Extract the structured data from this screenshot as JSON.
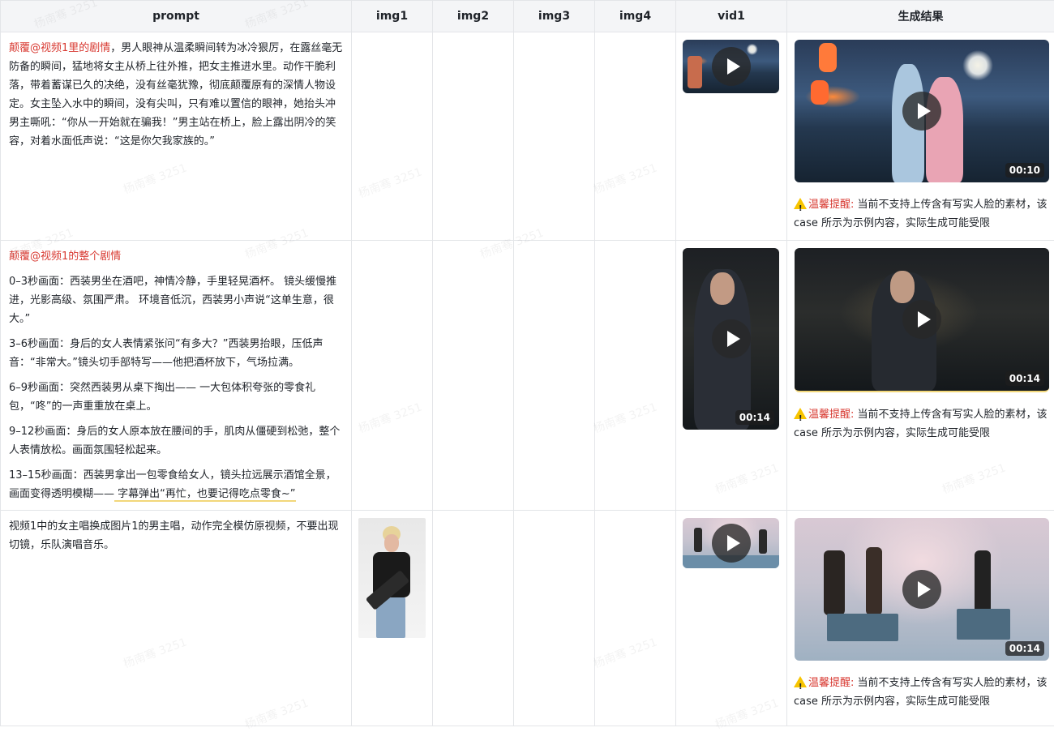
{
  "columns": [
    "prompt",
    "img1",
    "img2",
    "img3",
    "img4",
    "vid1",
    "生成结果"
  ],
  "rows": [
    {
      "paragraphs": [
        {
          "highlight": "颠覆@视频1里的剧情",
          "text": "，男人眼神从温柔瞬间转为冰冷狠厉，在露丝毫无防备的瞬间，猛地将女主从桥上往外推，把女主推进水里。动作干脆利落，带着蓄谋已久的决绝，没有丝毫犹豫，彻底颠覆原有的深情人物设定。女主坠入水中的瞬间，没有尖叫，只有难以置信的眼神，她抬头冲男主嘶吼：“你从一开始就在骗我！”男主站在桥上，脸上露出阴冷的笑容，对着水面低声说：“这是你欠我家族的。”"
        }
      ],
      "vid1": {
        "duration": "",
        "icon": "play-icon"
      },
      "result": {
        "duration": "00:10",
        "warning_label": "温馨提醒:",
        "warning_text": " 当前不支持上传含有写实人脸的素材，该 case 所示为示例内容，实际生成可能受限"
      }
    },
    {
      "paragraphs": [
        {
          "highlight": "颠覆@视频1的整个剧情",
          "text": ""
        },
        {
          "highlight": "",
          "text": "0–3秒画面：西装男坐在酒吧，神情冷静，手里轻晃酒杯。 镜头缓慢推进，光影高级、氛围严肃。 环境音低沉，西装男小声说“这单生意，很大。”"
        },
        {
          "highlight": "",
          "text": "3–6秒画面：身后的女人表情紧张问“有多大？”西装男抬眼，压低声音：“非常大。”镜头切手部特写——他把酒杯放下，气场拉满。"
        },
        {
          "highlight": "",
          "text": "6–9秒画面：突然西装男从桌下掏出—— 一大包体积夸张的零食礼包，“咚”的一声重重放在桌上。"
        },
        {
          "highlight": "",
          "text": "9–12秒画面：身后的女人原本放在腰间的手，肌肉从僵硬到松弛，整个人表情放松。画面氛围轻松起来。"
        },
        {
          "highlight": "",
          "text": "13–15秒画面：西装男拿出一包零食给女人，镜头拉远展示酒馆全景，画面变得透明模糊——",
          "underlined": " 字幕弹出“再忙，也要记得吃点零食~”"
        }
      ],
      "vid1": {
        "duration": "00:14",
        "icon": "play-icon"
      },
      "result": {
        "duration": "00:14",
        "warning_label": "温馨提醒:",
        "warning_text": " 当前不支持上传含有写实人脸的素材，该 case 所示为示例内容，实际生成可能受限"
      }
    },
    {
      "paragraphs": [
        {
          "highlight": "",
          "text": "视频1中的女主唱换成图片1的男主唱，动作完全模仿原视频，不要出现切镜，乐队演唱音乐。"
        }
      ],
      "vid1": {
        "duration": "",
        "icon": "play-icon"
      },
      "result": {
        "duration": "00:14",
        "warning_label": "温馨提醒:",
        "warning_text": " 当前不支持上传含有写实人脸的素材，该 case 所示为示例内容，实际生成可能受限"
      }
    }
  ],
  "watermark": "杨南骞 3251"
}
